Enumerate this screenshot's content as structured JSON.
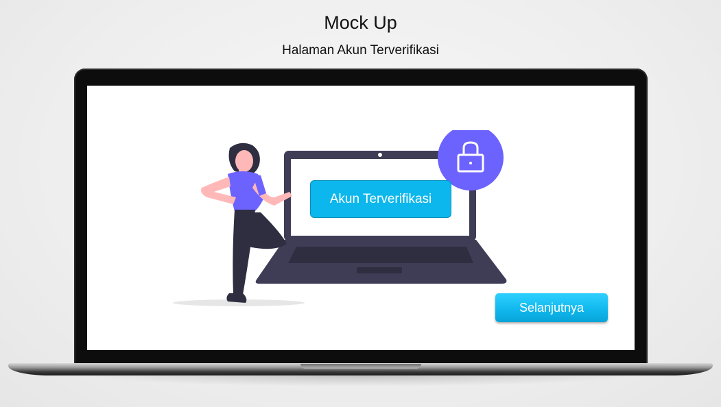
{
  "header": {
    "title": "Mock Up",
    "subtitle": "Halaman Akun Terverifikasi"
  },
  "screen": {
    "badge_label": "Akun Terverifikasi",
    "next_button_label": "Selanjutnya"
  },
  "colors": {
    "accent_blue": "#0bb7ec",
    "illustration_purple": "#6c63ff",
    "illustration_dark": "#3f3d56"
  },
  "icons": {
    "lock": "padlock-icon"
  }
}
